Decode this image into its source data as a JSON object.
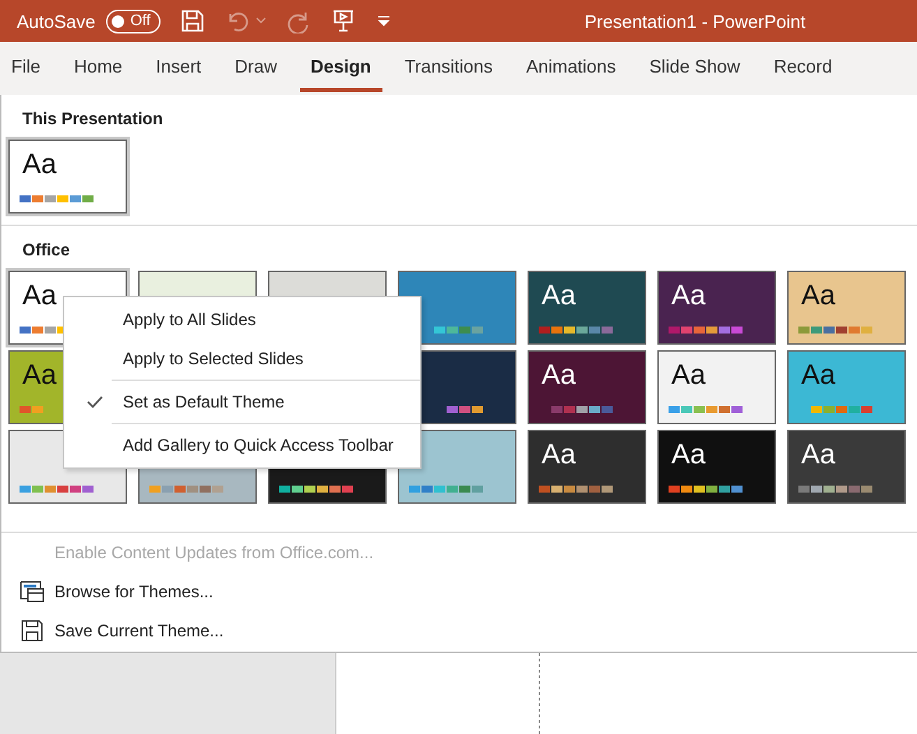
{
  "title_bar": {
    "autosave_label": "AutoSave",
    "autosave": {
      "on": false,
      "label": "Off"
    },
    "undo_disabled": true,
    "redo_disabled": true,
    "title": "Presentation1 - PowerPoint"
  },
  "tabs": [
    {
      "label": "File",
      "selected": false
    },
    {
      "label": "Home",
      "selected": false
    },
    {
      "label": "Insert",
      "selected": false
    },
    {
      "label": "Draw",
      "selected": false
    },
    {
      "label": "Design",
      "selected": true
    },
    {
      "label": "Transitions",
      "selected": false
    },
    {
      "label": "Animations",
      "selected": false
    },
    {
      "label": "Slide Show",
      "selected": false
    },
    {
      "label": "Record",
      "selected": false
    }
  ],
  "this_presentation": {
    "heading": "This Presentation",
    "themes": [
      {
        "sample": "Aa",
        "color": "#ffffff",
        "selected": true,
        "palette": [
          {
            "color": "#4472c4"
          },
          {
            "color": "#ed7d31"
          },
          {
            "color": "#a5a5a5"
          },
          {
            "color": "#ffc000"
          },
          {
            "color": "#5b9bd5"
          },
          {
            "color": "#70ad47"
          }
        ]
      }
    ]
  },
  "office": {
    "heading": "Office",
    "rows": [
      {
        "themes": [
          {
            "sample": "Aa",
            "color": "#ffffff",
            "selected": true,
            "palette": [
              {
                "color": "#4472c4"
              },
              {
                "color": "#ed7d31"
              },
              {
                "color": "#a5a5a5"
              },
              {
                "color": "#ffc000"
              }
            ]
          },
          {
            "color": "#e9f0df",
            "selected": false
          },
          {
            "color": "#dcdcd8",
            "selected": false
          },
          {
            "color": "#2e86b8",
            "selected": false,
            "palette": [
              {
                "color": "#34c6d6"
              },
              {
                "color": "#4db89a"
              },
              {
                "color": "#3d8d4e"
              },
              {
                "color": "#6aa3a0"
              }
            ]
          },
          {
            "sample": "Aa",
            "color": "#1f4a52",
            "selected": false,
            "palette": [
              {
                "color": "#b01e1e"
              },
              {
                "color": "#e8730c"
              },
              {
                "color": "#e6b82a"
              },
              {
                "color": "#6ba89a"
              },
              {
                "color": "#5a87a8"
              },
              {
                "color": "#8a6a9a"
              }
            ]
          },
          {
            "sample": "Aa",
            "color": "#4a2350",
            "selected": false,
            "palette": [
              {
                "color": "#b0186a"
              },
              {
                "color": "#e0436f"
              },
              {
                "color": "#e8653a"
              },
              {
                "color": "#e59a3a"
              },
              {
                "color": "#a36ee0"
              },
              {
                "color": "#c94ad6"
              }
            ]
          },
          {
            "sample": "Aa",
            "color": "#e8c58e",
            "selected": false,
            "palette": [
              {
                "color": "#8c9a3a"
              },
              {
                "color": "#3e9a7a"
              },
              {
                "color": "#4a6fa0"
              },
              {
                "color": "#a04030"
              },
              {
                "color": "#e07a30"
              },
              {
                "color": "#e0b040"
              }
            ]
          }
        ]
      },
      {
        "themes": [
          {
            "sample": "Aa",
            "color": "#a2b52a",
            "selected": false,
            "palette": [
              {
                "color": "#e0562a"
              },
              {
                "color": "#f0a020"
              }
            ]
          },
          {
            "color": "#1a2c45",
            "selected": false,
            "palette": [
              {
                "color": "#a060d0"
              },
              {
                "color": "#d05080"
              },
              {
                "color": "#e09a30"
              }
            ]
          },
          {
            "sample": "Aa",
            "color": "#4d1535",
            "selected": false,
            "palette": [
              {
                "color": "#8a3a6a"
              },
              {
                "color": "#b03050"
              },
              {
                "color": "#a0a0a8"
              },
              {
                "color": "#6aaac8"
              },
              {
                "color": "#4a5a9a"
              }
            ]
          },
          {
            "sample": "Aa",
            "color": "#f2f2f2",
            "selected": false,
            "palette": [
              {
                "color": "#3aa0e8"
              },
              {
                "color": "#4ac8b8"
              },
              {
                "color": "#8ac050"
              },
              {
                "color": "#e89a30"
              },
              {
                "color": "#d07030"
              },
              {
                "color": "#a060d8"
              }
            ]
          },
          {
            "sample": "Aa",
            "color": "#3cb8d4",
            "selected": false,
            "palette": [
              {
                "color": "#f0b800"
              },
              {
                "color": "#8ab030"
              },
              {
                "color": "#e06a10"
              },
              {
                "color": "#20b0a0"
              },
              {
                "color": "#d84030"
              }
            ]
          }
        ]
      },
      {
        "themes": [
          {
            "color": "#e8e8e8",
            "selected": false,
            "palette": [
              {
                "color": "#3aa0e0"
              },
              {
                "color": "#80c050"
              },
              {
                "color": "#e09030"
              },
              {
                "color": "#d84040"
              },
              {
                "color": "#d04080"
              },
              {
                "color": "#a060d0"
              }
            ]
          },
          {
            "color": "#a8b8c0",
            "selected": false,
            "palette": [
              {
                "color": "#f0a020"
              },
              {
                "color": "#8aa0b0"
              },
              {
                "color": "#d06030"
              },
              {
                "color": "#a09080"
              },
              {
                "color": "#907060"
              },
              {
                "color": "#b0a090"
              }
            ]
          },
          {
            "color": "#1a1a1a",
            "selected": false,
            "palette": [
              {
                "color": "#10b0a0"
              },
              {
                "color": "#60d090"
              },
              {
                "color": "#b0d050"
              },
              {
                "color": "#e0b040"
              },
              {
                "color": "#e07050"
              },
              {
                "color": "#e04050"
              }
            ]
          },
          {
            "color": "#9cc4d0",
            "selected": false,
            "palette": [
              {
                "color": "#30a0e0"
              },
              {
                "color": "#3080c8"
              },
              {
                "color": "#30c0d0"
              },
              {
                "color": "#40b090"
              },
              {
                "color": "#3a8a50"
              },
              {
                "color": "#60a0a0"
              }
            ]
          },
          {
            "sample": "Aa",
            "color": "#2e2e2e",
            "selected": false,
            "palette": [
              {
                "color": "#c05020"
              },
              {
                "color": "#d8b070"
              },
              {
                "color": "#c88a40"
              },
              {
                "color": "#b09070"
              },
              {
                "color": "#a06040"
              },
              {
                "color": "#b09878"
              }
            ]
          },
          {
            "sample": "Aa",
            "color": "#101010",
            "selected": false,
            "palette": [
              {
                "color": "#e04020"
              },
              {
                "color": "#f08a10"
              },
              {
                "color": "#e0c020"
              },
              {
                "color": "#80b040"
              },
              {
                "color": "#30a0a0"
              },
              {
                "color": "#5090d0"
              }
            ]
          },
          {
            "sample": "Aa",
            "color": "#3a3a3a",
            "selected": false,
            "palette": [
              {
                "color": "#7a7a7a"
              },
              {
                "color": "#a0a8b0"
              },
              {
                "color": "#a0b090"
              },
              {
                "color": "#b09a8a"
              },
              {
                "color": "#8a6a70"
              },
              {
                "color": "#9a8a70"
              }
            ]
          }
        ]
      }
    ]
  },
  "commands": [
    {
      "kind": "plain",
      "label": "Enable Content Updates from Office.com...",
      "disabled": true
    },
    {
      "kind": "browse",
      "label": "Browse for Themes...",
      "disabled": false
    },
    {
      "kind": "save",
      "label": "Save Current Theme...",
      "disabled": false
    }
  ],
  "context_menu": [
    {
      "label": "Apply to All Slides",
      "checked": false,
      "separator_before": false
    },
    {
      "label": "Apply to Selected Slides",
      "checked": false,
      "separator_before": false
    },
    {
      "label": "Set as Default Theme",
      "checked": true,
      "separator_before": true
    },
    {
      "label": "Add Gallery to Quick Access Toolbar",
      "checked": false,
      "separator_before": true
    }
  ]
}
